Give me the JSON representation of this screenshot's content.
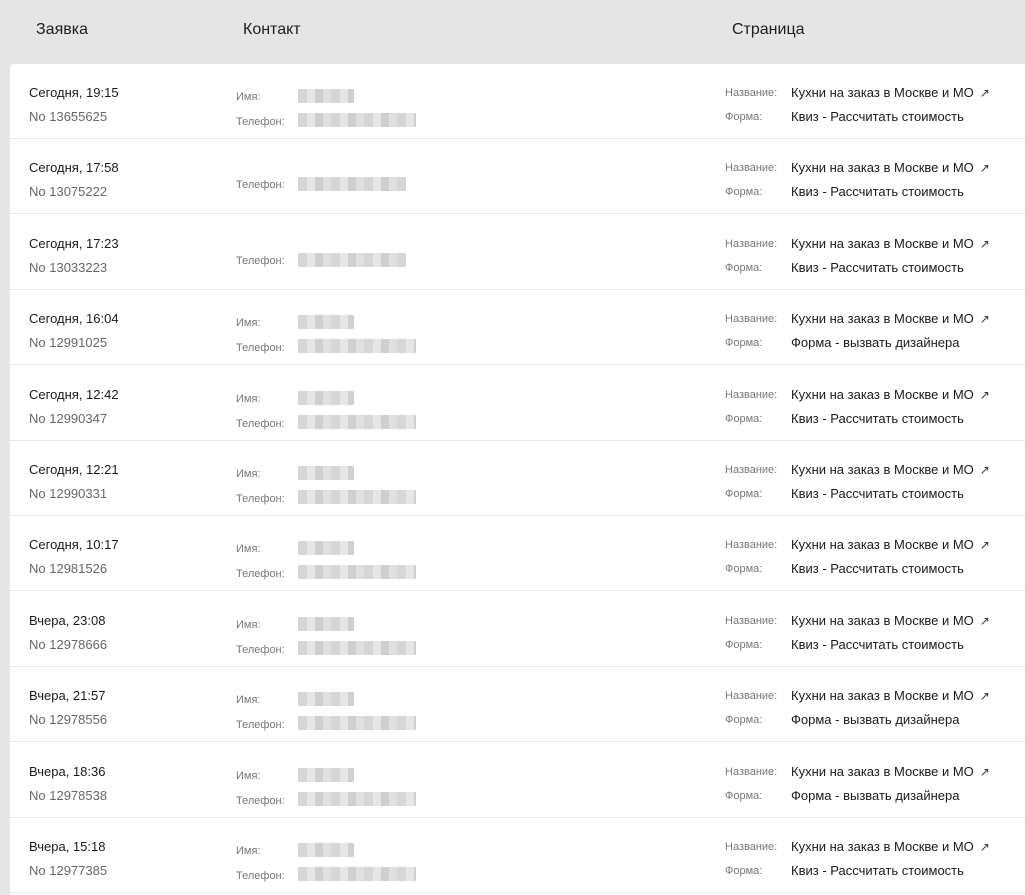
{
  "header": {
    "order": "Заявка",
    "contact": "Контакт",
    "page": "Страница"
  },
  "labels": {
    "name": "Имя:",
    "phone": "Телефон:",
    "title": "Название:",
    "form": "Форма:"
  },
  "icons": {
    "external_link": "arrow-up-right-icon"
  },
  "rows": [
    {
      "date": "Сегодня, 19:15",
      "number": "No 13655625",
      "has_name": true,
      "page_title": "Кухни на заказ в Москве и МО",
      "form": "Квиз - Рассчитать стоимость"
    },
    {
      "date": "Сегодня, 17:58",
      "number": "No 13075222",
      "has_name": false,
      "page_title": "Кухни на заказ в Москве и МО",
      "form": "Квиз - Рассчитать стоимость"
    },
    {
      "date": "Сегодня, 17:23",
      "number": "No 13033223",
      "has_name": false,
      "page_title": "Кухни на заказ в Москве и МО",
      "form": "Квиз - Рассчитать стоимость"
    },
    {
      "date": "Сегодня, 16:04",
      "number": "No 12991025",
      "has_name": true,
      "page_title": "Кухни на заказ в Москве и МО",
      "form": "Форма - вызвать дизайнера"
    },
    {
      "date": "Сегодня, 12:42",
      "number": "No 12990347",
      "has_name": true,
      "page_title": "Кухни на заказ в Москве и МО",
      "form": "Квиз - Рассчитать стоимость"
    },
    {
      "date": "Сегодня, 12:21",
      "number": "No 12990331",
      "has_name": true,
      "page_title": "Кухни на заказ в Москве и МО",
      "form": "Квиз - Рассчитать стоимость"
    },
    {
      "date": "Сегодня, 10:17",
      "number": "No 12981526",
      "has_name": true,
      "page_title": "Кухни на заказ в Москве и МО",
      "form": "Квиз - Рассчитать стоимость"
    },
    {
      "date": "Вчера, 23:08",
      "number": "No 12978666",
      "has_name": true,
      "page_title": "Кухни на заказ в Москве и МО",
      "form": "Квиз - Рассчитать стоимость"
    },
    {
      "date": "Вчера, 21:57",
      "number": "No 12978556",
      "has_name": true,
      "page_title": "Кухни на заказ в Москве и МО",
      "form": "Форма - вызвать дизайнера"
    },
    {
      "date": "Вчера, 18:36",
      "number": "No 12978538",
      "has_name": true,
      "page_title": "Кухни на заказ в Москве и МО",
      "form": "Форма - вызвать дизайнера"
    },
    {
      "date": "Вчера, 15:18",
      "number": "No 12977385",
      "has_name": true,
      "page_title": "Кухни на заказ в Москве и МО",
      "form": "Квиз - Рассчитать стоимость"
    }
  ]
}
